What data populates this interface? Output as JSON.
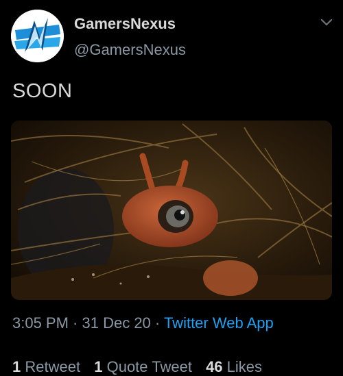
{
  "user": {
    "display_name": "GamersNexus",
    "handle": "@GamersNexus",
    "avatar_icon": "gamersnexus-logo-icon"
  },
  "tweet": {
    "text": "SOON",
    "media_alt_icon": "photo-cartoon-ant-in-grass"
  },
  "meta": {
    "time": "3:05 PM",
    "sep1": " · ",
    "date": "31 Dec 20",
    "sep2": " · ",
    "source": "Twitter Web App"
  },
  "stats": {
    "retweets_count": "1",
    "retweets_label": "Retweet",
    "quotes_count": "1",
    "quotes_label": "Quote Tweet",
    "likes_count": "46",
    "likes_label": "Likes"
  },
  "colors": {
    "background": "#000000",
    "text": "#d9d9d9",
    "secondary": "#8b98a5",
    "link": "#1da1f2"
  }
}
